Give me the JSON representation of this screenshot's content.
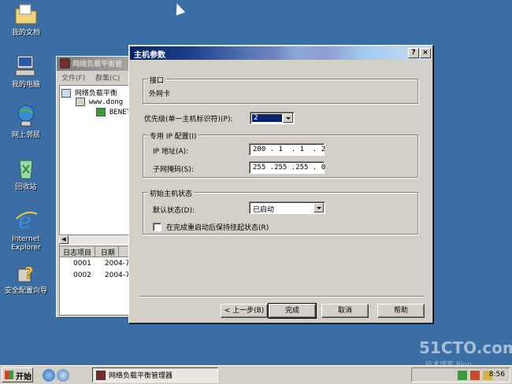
{
  "desktop": {
    "icons": [
      {
        "label": "我的文档"
      },
      {
        "label": "我的电脑"
      },
      {
        "label": "网上邻居"
      },
      {
        "label": "回收站"
      },
      {
        "label": "Internet Explorer"
      },
      {
        "label": "安全配置向导"
      }
    ]
  },
  "bg_window": {
    "title": "网络负载平衡管",
    "menu": [
      "文件(F)",
      "群集(C)"
    ],
    "tree": [
      "网络负载平衡",
      "www.dong",
      "BENET"
    ],
    "log_headers": [
      "日志项目",
      "日期"
    ],
    "log_rows": [
      {
        "id": "0001",
        "date": "2004-7-"
      },
      {
        "id": "0002",
        "date": "2004-7-"
      }
    ]
  },
  "dialog": {
    "title": "主机参数",
    "help_label": "?",
    "close_label": "×",
    "interface": {
      "legend": "接口",
      "value": "外网卡"
    },
    "priority": {
      "label": "优先级(单一主机标识符)(P):",
      "value": "2"
    },
    "ip_config": {
      "legend": "专用 IP 配置(I)",
      "ip_label": "IP 地址(A):",
      "ip_value": "200 . 1  . 1  . 2",
      "mask_label": "子网掩码(S):",
      "mask_value": "255 .255 .255 . 0"
    },
    "initial_state": {
      "legend": "初始主机状态",
      "default_label": "默认状态(D):",
      "default_value": "已启动",
      "keep_suspended_label": "在完成重启动后保持挂起状态(R)"
    },
    "buttons": {
      "back": "< 上一步(B)",
      "finish": "完成",
      "cancel": "取消",
      "help": "帮助"
    }
  },
  "taskbar": {
    "start_label": "开始",
    "task_label": "网络负载平衡管理器",
    "clock": "8:56"
  },
  "watermark": {
    "main": "51CTO.com",
    "sub": "技术博客 Blog"
  }
}
